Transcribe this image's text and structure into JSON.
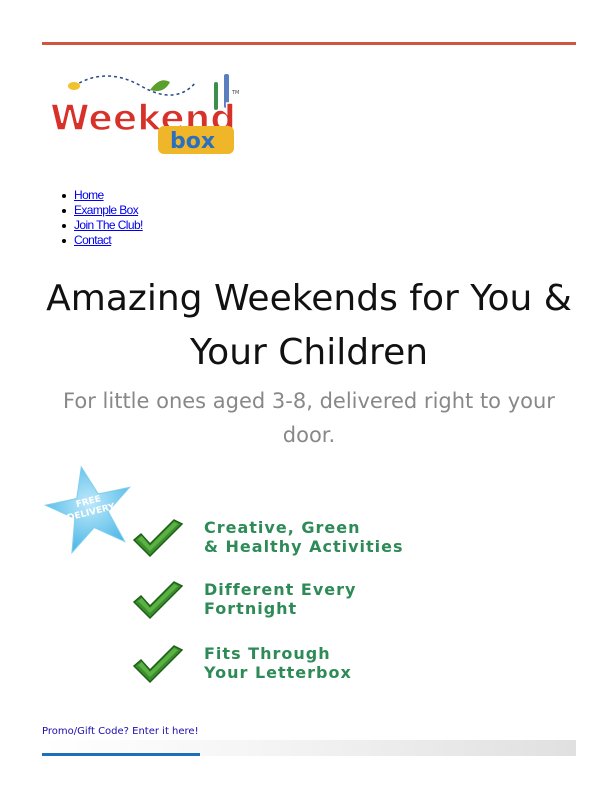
{
  "logo": {
    "word_main": "Weekend",
    "word_sub": "box",
    "tm": "TM"
  },
  "nav": {
    "items": [
      {
        "label": "Home"
      },
      {
        "label": "Example Box"
      },
      {
        "label": "Join The Club!"
      },
      {
        "label": "Contact"
      }
    ]
  },
  "hero": {
    "headline_line1": "Amazing Weekends for You &",
    "headline_line2": "Your Children",
    "subheading": "For little ones aged 3-8, delivered right to your door."
  },
  "badge": {
    "text_line1": "FREE",
    "text_line2": "DELIVERY",
    "color": "#59c2ec"
  },
  "features": [
    {
      "text": "Creative, Green\n& Healthy Activities"
    },
    {
      "text": "Different Every\nFortnight"
    },
    {
      "text": "Fits Through\nYour Letterbox"
    }
  ],
  "promo": {
    "link_text": "Promo/Gift Code? Enter it here!"
  },
  "colors": {
    "top_rule": "#d0553f",
    "feature_text": "#2e8b57",
    "check": "#3b8f2c",
    "accent_bar": "#1e6fb8"
  }
}
